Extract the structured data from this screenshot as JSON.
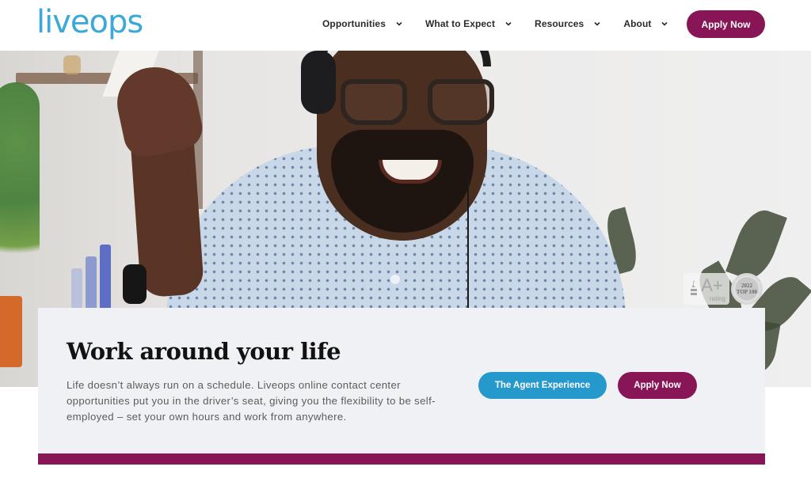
{
  "header": {
    "logo_text": "liveops",
    "nav": [
      {
        "label": "Opportunities",
        "icon": "chevron-down-icon"
      },
      {
        "label": "What to Expect",
        "icon": "chevron-down-icon"
      },
      {
        "label": "Resources",
        "icon": "chevron-down-icon"
      },
      {
        "label": "About",
        "icon": "chevron-down-icon"
      }
    ],
    "apply_label": "Apply Now"
  },
  "hero": {
    "image_description": "Smiling man with glasses and headset in a patterned blue shirt",
    "badges": {
      "bbb_label": "BBB",
      "bbb_grade": "A+",
      "bbb_rating_text": "rating",
      "seal_year": "2022",
      "seal_text": "TOP 100"
    }
  },
  "card": {
    "title": "Work around your life",
    "body": "Life doesn’t always run on a schedule. Liveops online contact center opportunities put you in the driver’s seat, giving you the flexibility to be self-employed – set your own hours and work from anywhere.",
    "agent_button_label": "The Agent Experience",
    "apply_button_label": "Apply Now"
  },
  "colors": {
    "brand_blue": "#3aa8d8",
    "button_blue": "#2598cc",
    "brand_plum": "#881657",
    "card_bg": "#f0f1f4"
  }
}
